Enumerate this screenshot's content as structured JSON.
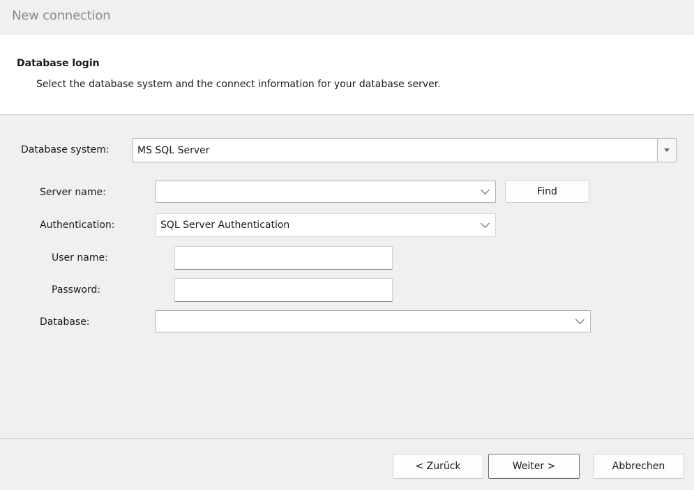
{
  "window": {
    "title": "New connection"
  },
  "header": {
    "title": "Database login",
    "subtitle": "Select the database system and the connect information for your database server."
  },
  "form": {
    "database_system": {
      "label": "Database system:",
      "value": "MS SQL Server"
    },
    "server_name": {
      "label": "Server name:",
      "value": "",
      "find_label": "Find"
    },
    "authentication": {
      "label": "Authentication:",
      "value": "SQL Server Authentication"
    },
    "user_name": {
      "label": "User name:",
      "value": ""
    },
    "password": {
      "label": "Password:",
      "value": ""
    },
    "database": {
      "label": "Database:",
      "value": ""
    }
  },
  "footer": {
    "back_label": "< Zurück",
    "next_label": "Weiter >",
    "cancel_label": "Abbrechen"
  },
  "icons": {
    "database_system_dropdown": "triangle-down-icon",
    "server_name_dropdown": "chevron-down-icon",
    "authentication_dropdown": "chevron-down-icon",
    "database_dropdown": "chevron-down-icon"
  }
}
